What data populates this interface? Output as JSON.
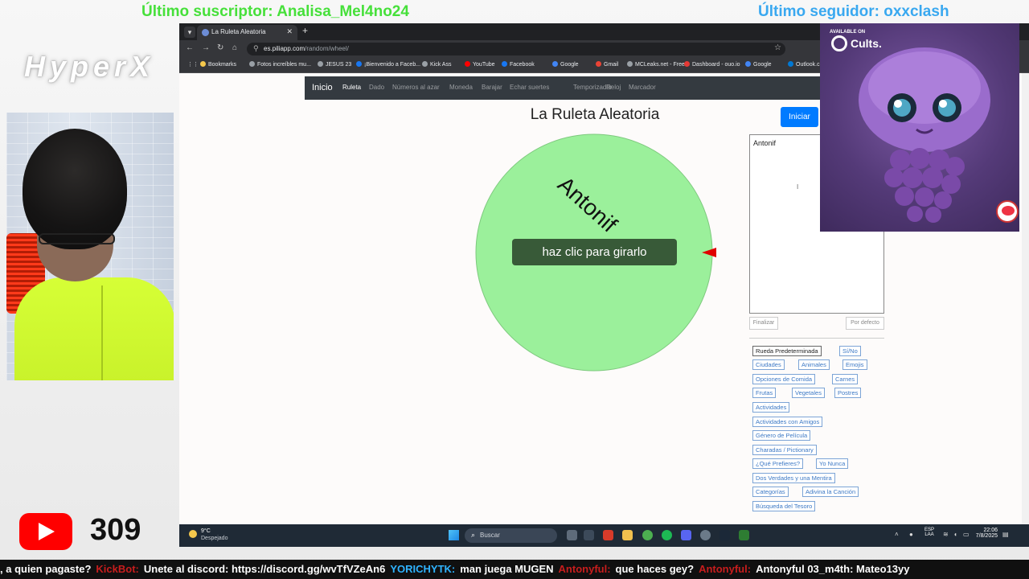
{
  "overlay": {
    "last_subscriber": "Último suscriptor: Analisa_Mel4no24",
    "last_follower": "Último seguidor: oxxclash",
    "brand": "HyperX",
    "youtube_count": "309",
    "ticker": [
      {
        "text": ", a quien pagaste?",
        "style": "w"
      },
      {
        "text": "KickBot:",
        "style": "r"
      },
      {
        "text": "Unete al discord: https://discord.gg/wvTfVZeAn6",
        "style": "w"
      },
      {
        "text": "YORICHYTK:",
        "style": "b"
      },
      {
        "text": "man juega MUGEN",
        "style": "w"
      },
      {
        "text": "Antonyful:",
        "style": "r"
      },
      {
        "text": "que haces gey?",
        "style": "w"
      },
      {
        "text": "Antonyful:",
        "style": "r"
      },
      {
        "text": "Antonyful  03_m4th:  Mateo13yy",
        "style": "w"
      }
    ],
    "sponsor": {
      "available_on": "AVAILABLE ON",
      "name": "Cults."
    }
  },
  "browser": {
    "tab_title": "La Ruleta Aleatoria",
    "url_host": "es.piliapp.com",
    "url_path": "/random/wheel/",
    "bookmarks": [
      {
        "label": "Bookmarks",
        "color": "#f5c84c"
      },
      {
        "label": "Fotos increíbles mu...",
        "color": "#9aa0a6"
      },
      {
        "label": "JESUS 23",
        "color": "#9aa0a6"
      },
      {
        "label": "¡Bienvenido a Faceb...",
        "color": "#1877f2"
      },
      {
        "label": "Kick Ass",
        "color": "#9aa0a6"
      },
      {
        "label": "YouTube",
        "color": "#ff0000"
      },
      {
        "label": "Facebook",
        "color": "#1877f2"
      },
      {
        "label": "Google",
        "color": "#4285f4"
      },
      {
        "label": "Gmail",
        "color": "#ea4335"
      },
      {
        "label": "MCLeaks.net - Free...",
        "color": "#9aa0a6"
      },
      {
        "label": "Dashboard - ouo.io",
        "color": "#e53935"
      },
      {
        "label": "Google",
        "color": "#4285f4"
      },
      {
        "label": "Outlook.c",
        "color": "#0078d4"
      }
    ]
  },
  "site": {
    "brand": "Inicio",
    "nav": [
      "Ruleta",
      "Dado",
      "Números al azar",
      "Moneda",
      "Barajar",
      "Echar suertes",
      "Temporizador",
      "Reloj",
      "Marcador"
    ],
    "title": "La Ruleta Aleatoria",
    "start_button": "Iniciar",
    "wheel_label": "Antonif",
    "spin_label": "haz clic para girarlo",
    "names_value": "Antonif",
    "finish_button": "Finalizar",
    "default_button": "Por defecto",
    "presets": [
      "Rueda Predeterminada",
      "Sí/No",
      "Ciudades",
      "Animales",
      "Emojis",
      "Opciones de Comida",
      "Carnes",
      "Frutas",
      "Vegetales",
      "Postres",
      "Actividades",
      "Actividades con Amigos",
      "Género de Película",
      "Charadas / Pictionary",
      "¿Qué Prefieres?",
      "Yo Nunca",
      "Dos Verdades y una Mentira",
      "Categorías",
      "Adivina la Canción",
      "Búsqueda del Tesoro"
    ],
    "colors": {
      "wheel": "#9bf09b",
      "spin_button": "#385a38",
      "pointer": "#e00000",
      "primary": "#007bff"
    }
  },
  "taskbar": {
    "temperature": "9°C",
    "condition": "Despejado",
    "search": "Buscar",
    "lang_top": "ESP",
    "lang_bottom": "LAA",
    "time": "22:06",
    "date": "7/8/2025"
  }
}
